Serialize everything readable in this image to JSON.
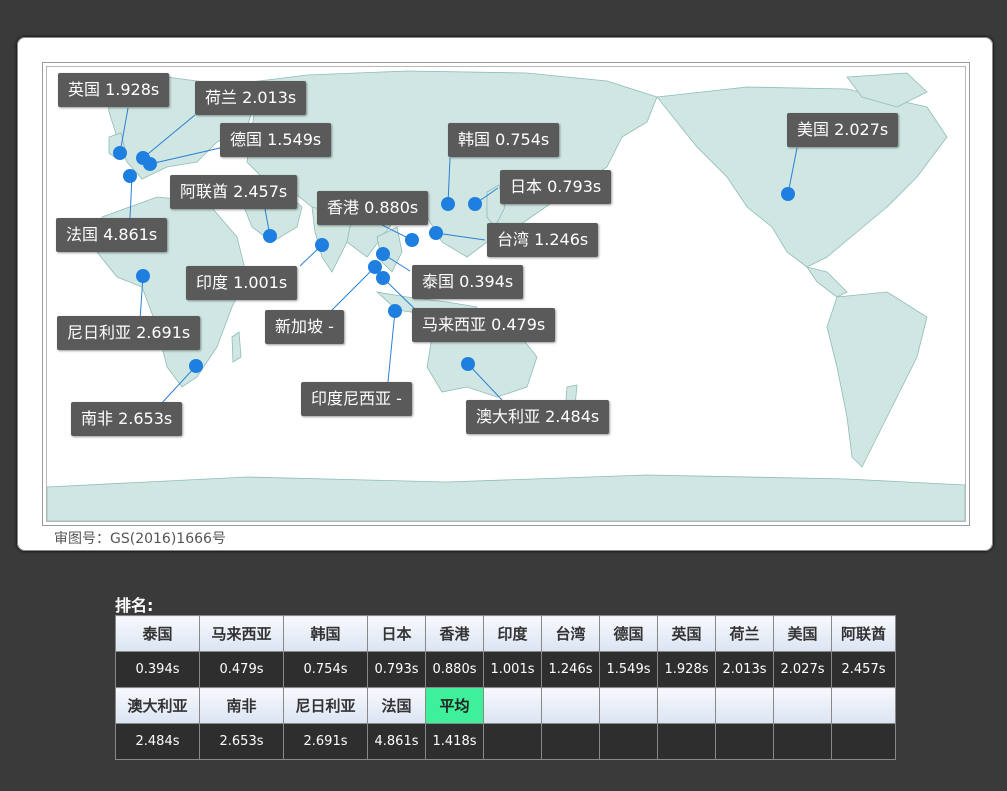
{
  "map": {
    "caption": "审图号：GS(2016)1666号",
    "point_color": "#1e7fe0",
    "points": [
      {
        "label": "英国 1.928s"
      },
      {
        "label": "荷兰 2.013s"
      },
      {
        "label": "德国 1.549s"
      },
      {
        "label": "法国 4.861s"
      },
      {
        "label": "阿联酋 2.457s"
      },
      {
        "label": "印度 1.001s"
      },
      {
        "label": "尼日利亚 2.691s"
      },
      {
        "label": "南非 2.653s"
      },
      {
        "label": "新加坡 -"
      },
      {
        "label": "印度尼西亚 -"
      },
      {
        "label": "香港 0.880s"
      },
      {
        "label": "泰国 0.394s"
      },
      {
        "label": "马来西亚 0.479s"
      },
      {
        "label": "韩国 0.754s"
      },
      {
        "label": "日本 0.793s"
      },
      {
        "label": "台湾 1.246s"
      },
      {
        "label": "澳大利亚 2.484s"
      },
      {
        "label": "美国 2.027s"
      }
    ]
  },
  "ranking": {
    "title": "排名:",
    "row1": [
      {
        "name": "泰国",
        "time": "0.394s"
      },
      {
        "name": "马来西亚",
        "time": "0.479s"
      },
      {
        "name": "韩国",
        "time": "0.754s"
      },
      {
        "name": "日本",
        "time": "0.793s"
      },
      {
        "name": "香港",
        "time": "0.880s"
      },
      {
        "name": "印度",
        "time": "1.001s"
      },
      {
        "name": "台湾",
        "time": "1.246s"
      },
      {
        "name": "德国",
        "time": "1.549s"
      },
      {
        "name": "英国",
        "time": "1.928s"
      },
      {
        "name": "荷兰",
        "time": "2.013s"
      },
      {
        "name": "美国",
        "time": "2.027s"
      },
      {
        "name": "阿联酋",
        "time": "2.457s"
      }
    ],
    "row2": [
      {
        "name": "澳大利亚",
        "time": "2.484s"
      },
      {
        "name": "南非",
        "time": "2.653s"
      },
      {
        "name": "尼日利亚",
        "time": "2.691s"
      },
      {
        "name": "法国",
        "time": "4.861s"
      },
      {
        "name": "平均",
        "time": "1.418s"
      }
    ],
    "average_color": "#3ff09a"
  }
}
